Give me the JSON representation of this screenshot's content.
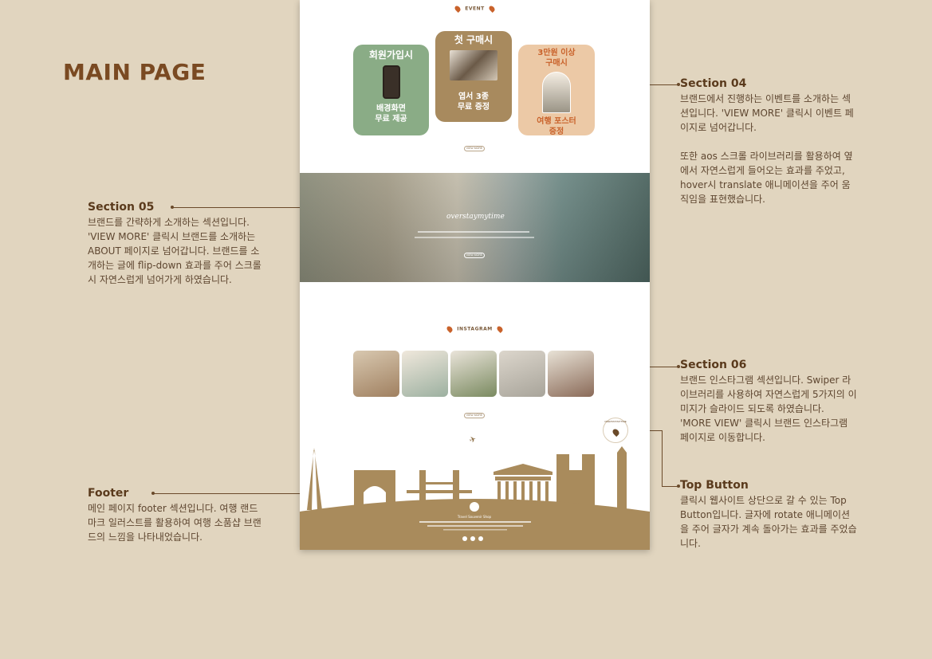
{
  "title": "MAIN PAGE",
  "notes": {
    "s04": {
      "heading": "Section 04",
      "body": "브랜드에서 진행하는 이벤트를 소개하는 섹션입니다. 'VIEW MORE' 클릭시 이벤트 페이지로 넘어갑니다.\n\n또한 aos 스크롤 라이브러리를 활용하여 옆에서 자연스럽게 들어오는 효과를 주었고, hover시 translate 애니메이션을 주어 움직임을 표현했습니다."
    },
    "s05": {
      "heading": "Section 05",
      "body": "브랜드를 간략하게 소개하는 섹션입니다. 'VIEW MORE' 클릭시 브랜드를 소개하는 ABOUT 페이지로 넘어갑니다. 브랜드를 소개하는 글에 flip-down 효과를 주어 스크롤시 자연스럽게 넘어가게 하였습니다."
    },
    "s06": {
      "heading": "Section 06",
      "body": "브랜드 인스타그램 섹션입니다. Swiper 라이브러리를 사용하여 자연스럽게 5가지의 이미지가 슬라이드 되도록 하였습니다. 'MORE VIEW' 클릭시 브랜드 인스타그램 페이지로 이동합니다."
    },
    "topbtn": {
      "heading": "Top Button",
      "body": "클릭시 웹사이트 상단으로 갈 수 있는 Top Button입니다. 글자에 rotate 애니메이션을 주어 글자가 계속 돌아가는 효과를 주었습니다."
    },
    "footer": {
      "heading": "Footer",
      "body": "메인 페이지 footer 섹션입니다. 여행 랜드마크 일러스트를 활용하여 여행 소품샵 브랜드의 느낌을 나타내었습니다."
    }
  },
  "mock": {
    "event_label": "EVENT",
    "cards": [
      {
        "top": "회원가입시",
        "bottom": "배경화면\n무료 제공"
      },
      {
        "top": "첫 구매시",
        "bottom": "엽서 3종\n무료 증정"
      },
      {
        "top": "3만원 이상\n구매시",
        "bottom": "여행 포스터\n증정"
      }
    ],
    "view_more": "VIEW MORE",
    "banner_title": "overstaymytime",
    "instagram_label": "INSTAGRAM",
    "top_button_text": "OVERSTAYMYTIME",
    "footer_brand": "Travel Souvenir Shop"
  },
  "colors": {
    "card1": "#8aac86",
    "card2": "#a88a5e",
    "card3": "#ecc9a6",
    "footer": "#a98b5c",
    "accent": "#c9622b"
  }
}
